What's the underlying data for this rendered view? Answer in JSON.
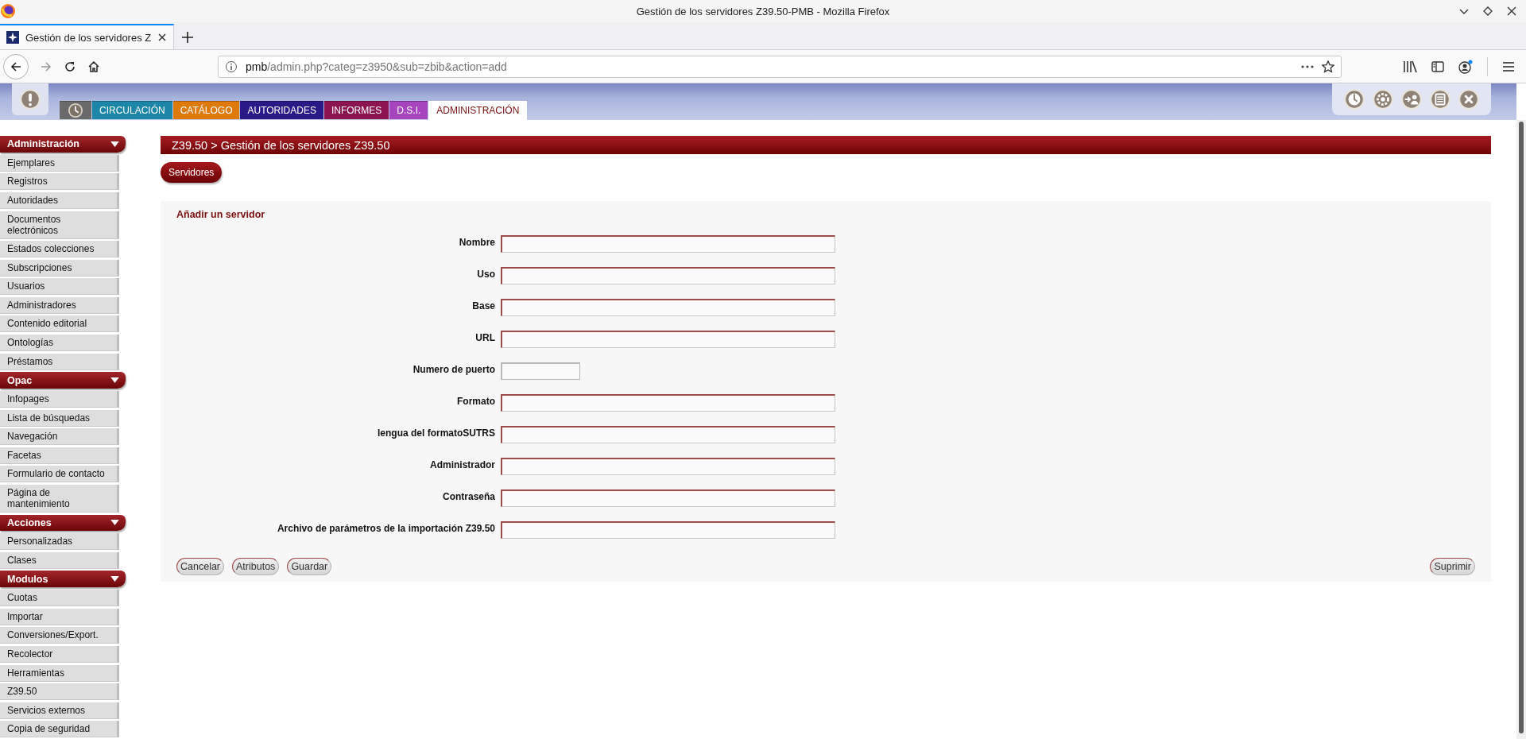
{
  "browser": {
    "window_title": "Gestión de los servidores Z39.50-PMB - Mozilla Firefox",
    "tab_title": "Gestión de los servidores Z",
    "url_host": "pmb",
    "url_path": "/admin.php?categ=z3950&sub=zbib&action=add"
  },
  "top_tabs": [
    {
      "kind": "icon",
      "color": "#6a6a6a",
      "selected": false
    },
    {
      "kind": "text",
      "label": "CIRCULACIÓN",
      "color": "#1b86a8",
      "selected": false
    },
    {
      "kind": "text",
      "label": "CATÁLOGO",
      "color": "#de7a0c",
      "selected": false
    },
    {
      "kind": "text",
      "label": "AUTORIDADES",
      "color": "#2a1a88",
      "selected": false
    },
    {
      "kind": "text",
      "label": "INFORMES",
      "color": "#8c1450",
      "selected": false
    },
    {
      "kind": "text",
      "label": "D.S.I.",
      "color": "#a645bd",
      "selected": false
    },
    {
      "kind": "text",
      "label": "ADMINISTRACIÓN",
      "color": "#ffffff",
      "selected": true
    }
  ],
  "sidebar": [
    {
      "title": "Administración",
      "expanded": true,
      "items": [
        "Ejemplares",
        "Registros",
        "Autoridades",
        "Documentos electrónicos",
        "Estados colecciones",
        "Subscripciones",
        "Usuarios",
        "Administradores",
        "Contenido editorial",
        "Ontologías",
        "Préstamos"
      ]
    },
    {
      "title": "Opac",
      "expanded": true,
      "items": [
        "Infopages",
        "Lista de búsquedas",
        "Navegación",
        "Facetas",
        "Formulario de contacto",
        "Página de mantenimiento"
      ]
    },
    {
      "title": "Acciones",
      "expanded": true,
      "items": [
        "Personalizadas",
        "Clases"
      ]
    },
    {
      "title": "Modulos",
      "expanded": true,
      "items": [
        "Cuotas",
        "Importar",
        "Conversiones/Export.",
        "Recolector",
        "Herramientas",
        "Z39.50",
        "Servicios externos",
        "Copia de seguridad"
      ]
    }
  ],
  "breadcrumb": "Z39.50 > Gestión de los servidores Z39.50",
  "sub_tabs": [
    "Servidores"
  ],
  "form": {
    "title": "Añadir un servidor",
    "fields": [
      {
        "label": "Nombre",
        "kind": "long"
      },
      {
        "label": "Uso",
        "kind": "long"
      },
      {
        "label": "Base",
        "kind": "long"
      },
      {
        "label": "URL",
        "kind": "long"
      },
      {
        "label": "Numero de puerto",
        "kind": "short"
      },
      {
        "label": "Formato",
        "kind": "long"
      },
      {
        "label": "lengua del formatoSUTRS",
        "kind": "long"
      },
      {
        "label": "Administrador",
        "kind": "long"
      },
      {
        "label": "Contraseña",
        "kind": "long"
      },
      {
        "label": "Archivo de parámetros de la importación Z39.50",
        "kind": "long"
      }
    ],
    "buttons_left": [
      "Cancelar",
      "Atributos",
      "Guardar"
    ],
    "buttons_right": [
      "Suprimir"
    ]
  }
}
